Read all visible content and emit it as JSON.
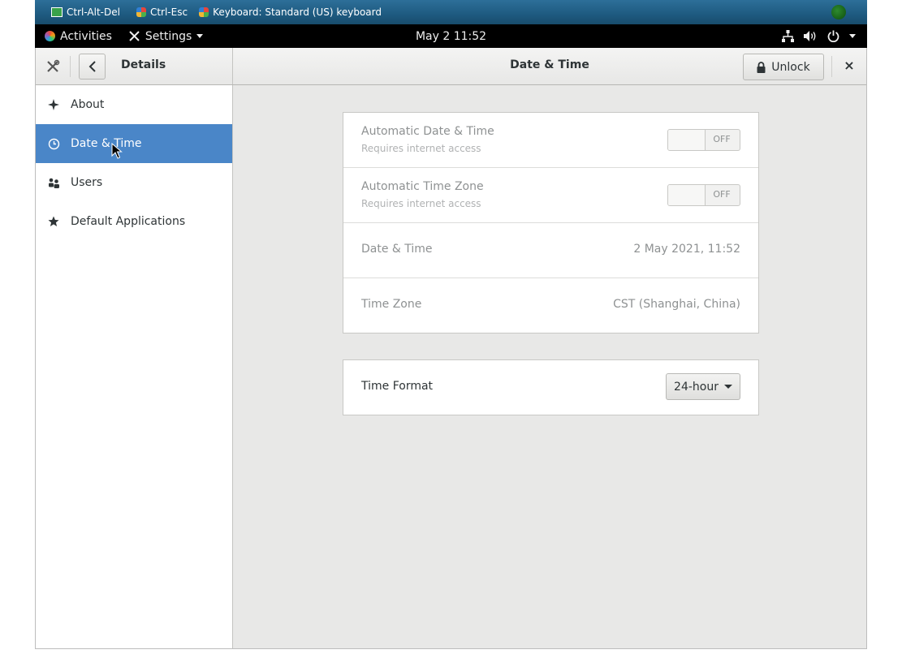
{
  "vnc_toolbar": {
    "items": [
      {
        "label": "Ctrl-Alt-Del",
        "icon": "ctrl-alt-del-icon"
      },
      {
        "label": "Ctrl-Esc",
        "icon": "windows-icon"
      },
      {
        "label": "Keyboard: Standard (US) keyboard",
        "icon": "windows-icon"
      }
    ],
    "status_icon": "connection-status-icon"
  },
  "top_panel": {
    "activities": "Activities",
    "app_menu": "Settings",
    "clock": "May 2  11:52",
    "tray_icons": [
      "network-icon",
      "volume-icon",
      "power-icon",
      "chevron-down-icon"
    ]
  },
  "window": {
    "left_title": "Details",
    "title": "Date & Time",
    "unlock_label": "Unlock",
    "close_label": "×"
  },
  "sidebar": {
    "items": [
      {
        "label": "About",
        "icon": "star-four-point-icon",
        "selected": false
      },
      {
        "label": "Date & Time",
        "icon": "clock-icon",
        "selected": true
      },
      {
        "label": "Users",
        "icon": "users-icon",
        "selected": false
      },
      {
        "label": "Default Applications",
        "icon": "star-icon",
        "selected": false
      }
    ]
  },
  "datetime": {
    "auto_datetime": {
      "label": "Automatic Date & Time",
      "sub": "Requires internet access",
      "state": "OFF"
    },
    "auto_timezone": {
      "label": "Automatic Time Zone",
      "sub": "Requires internet access",
      "state": "OFF"
    },
    "date_time": {
      "label": "Date & Time",
      "value": "2 May 2021, 11:52"
    },
    "time_zone": {
      "label": "Time Zone",
      "value": "CST (Shanghai, China)"
    }
  },
  "time_format": {
    "label": "Time Format",
    "value": "24-hour"
  },
  "colors": {
    "accent": "#4a86c8",
    "panel": "#000000",
    "vnc_bar": "#1e5a80"
  }
}
